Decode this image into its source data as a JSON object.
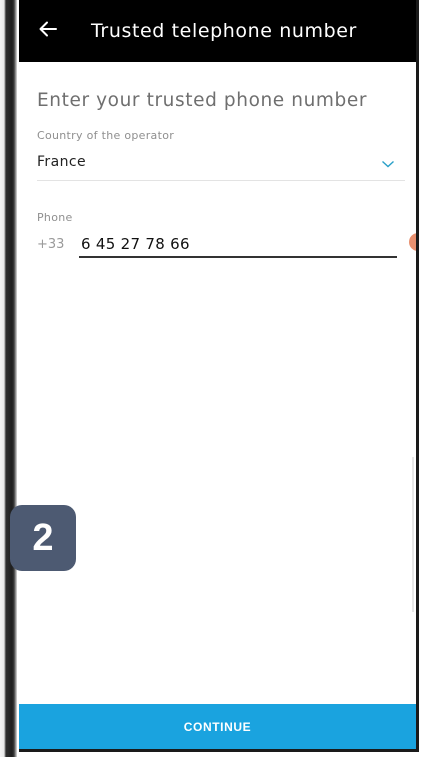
{
  "header": {
    "title": "Trusted telephone number",
    "back_icon": "arrow-left-icon"
  },
  "form": {
    "heading": "Enter your trusted phone number",
    "country": {
      "label": "Country of the operator",
      "value": "France",
      "dropdown_icon": "chevron-down-icon"
    },
    "phone": {
      "label": "Phone",
      "prefix": "+33",
      "value": "6 45 27 78 66"
    }
  },
  "step_badge": "2",
  "actions": {
    "continue_label": "CONTINUE"
  },
  "colors": {
    "app_bar": "#000000",
    "accent": "#1aa3df",
    "badge": "#4d5a72",
    "chevron": "#2aa0c8"
  }
}
